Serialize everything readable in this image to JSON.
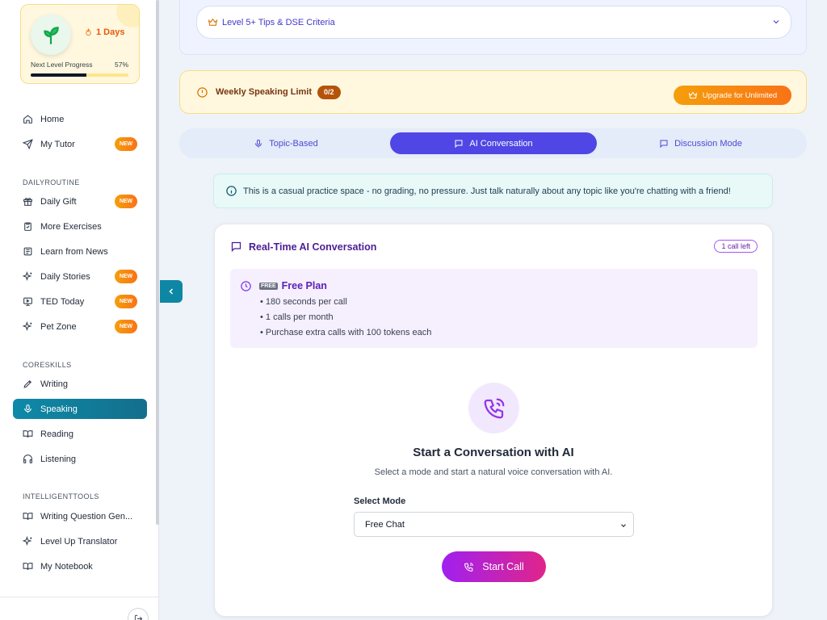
{
  "progress": {
    "days": "1 Days",
    "next_level_label": "Next Level Progress",
    "percent_text": "57%",
    "percent": 57
  },
  "nav": {
    "home": "Home",
    "my_tutor": "My Tutor",
    "new_badge": "NEW",
    "section_daily": "DAILYROUTINE",
    "daily_gift": "Daily Gift",
    "more_exercises": "More Exercises",
    "learn_news": "Learn from News",
    "daily_stories": "Daily Stories",
    "ted_today": "TED Today",
    "pet_zone": "Pet Zone",
    "section_core": "CORESKILLS",
    "writing": "Writing",
    "speaking": "Speaking",
    "reading": "Reading",
    "listening": "Listening",
    "section_tools": "INTELLIGENTTOOLS",
    "writing_gen": "Writing Question Gen...",
    "level_up": "Level Up Translator",
    "notebook": "My Notebook"
  },
  "tips": {
    "label": "Level 5+ Tips & DSE Criteria"
  },
  "limit": {
    "label": "Weekly Speaking Limit",
    "count": "0/2",
    "upgrade": "Upgrade for Unlimited"
  },
  "tabs": {
    "topic": "Topic-Based",
    "ai": "AI Conversation",
    "discussion": "Discussion Mode"
  },
  "info": {
    "text": "This is a casual practice space - no grading, no pressure. Just talk naturally about any topic like you're chatting with a friend!"
  },
  "card": {
    "title": "Real-Time AI Conversation",
    "calls_left": "1 call left",
    "plan_icon": "FREE",
    "plan_title": "Free Plan",
    "plan_lines": [
      "• 180 seconds per call",
      "• 1 calls per month",
      "• Purchase extra calls with 100 tokens each"
    ],
    "start_title": "Start a Conversation with AI",
    "start_sub": "Select a mode and start a natural voice conversation with AI.",
    "mode_label": "Select Mode",
    "mode_value": "Free Chat",
    "start_call": "Start Call"
  },
  "colors": {
    "accent": "#4f46e5",
    "sidebar_active": "#0e8aa8",
    "warning": "#f59e0b",
    "call_gradient_start": "#a020f0",
    "call_gradient_end": "#e0258a"
  }
}
